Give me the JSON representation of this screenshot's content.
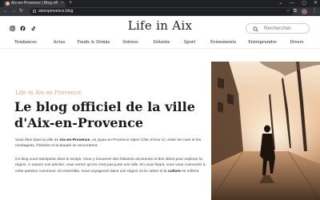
{
  "browser": {
    "tab_title": "Aix-en-Provence | Blog officiel",
    "tab_close": "×",
    "new_tab": "+",
    "url": "aixenprovence.blog",
    "window_controls": [
      "⌄",
      "—",
      "▢",
      "✕"
    ],
    "nav": {
      "back": "←",
      "forward": "→",
      "reload": "↻"
    },
    "toolbar_icons": [
      "extensions-icon",
      "menu-icon"
    ]
  },
  "site": {
    "brand": "Life in Aix",
    "social": [
      "instagram-icon",
      "facebook-icon",
      "tiktok-icon"
    ],
    "search_placeholder": "Rechercher",
    "nav": [
      "Tendances",
      "Actus",
      "Foods & Drinks",
      "Soirées",
      "Détente",
      "Sport",
      "Évènements",
      "Entreprendre",
      "Divers"
    ]
  },
  "hero": {
    "eyebrow": "Life in Aix en Provence",
    "headline": "Le blog officiel de la ville d'Aix-en-Provence",
    "p1_a": "Vous êtes dans la ville de ",
    "p1_b": "Aix-en-Provence",
    "p1_c": ", un joyau en Provence Alpes Côte d'Azur ici, entre les rues et les montagnes, l'histoire et la beauté se rencontrent.",
    "p2_a": "Ce blog vous transporte dans le temps. Vous y trouverez des histoires anciennes et des idées pour explorer la région. À travers nos articles, vous verrez qu'Aix n'est pas juste une ville. En nous lisant, vous vous connectez à cette passion commune. Et ensemble, nous voyageons dans une région où le calme et la ",
    "p2_b": "culture",
    "p2_c": " se mêlent."
  },
  "colors": {
    "accent": "#e8a27c",
    "chrome_dark": "#202124",
    "chrome_mid": "#35363a"
  }
}
